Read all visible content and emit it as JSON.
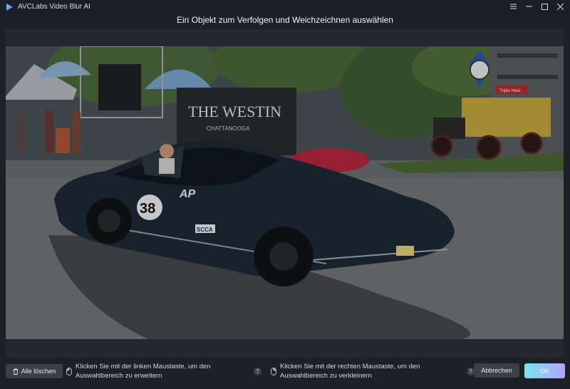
{
  "app": {
    "title": "AVCLabs Video Blur AI"
  },
  "dialog": {
    "title": "Ein Objekt zum Verfolgen und Weichzeichnen auswählen"
  },
  "window_controls": {
    "menu_icon": "hamburger-icon",
    "minimize_icon": "minimize-icon",
    "maximize_icon": "maximize-icon",
    "close_icon": "close-icon"
  },
  "video": {
    "sign_line1": "THE WESTIN",
    "sign_line2": "CHATTANOOGA",
    "car_number": "38",
    "car_letters": "AP",
    "car_badge": "SCCA",
    "truck_sign": "Triple Heat"
  },
  "bottom": {
    "clear_label": "Alle löschen",
    "hint_left": "Klicken Sie mit der linken Maustaste, um den Auswahlbereich zu erweitern",
    "hint_right": "Klicken Sie mit der rechten Maustaste, um den Auswahlbereich zu verkleinern",
    "help_glyph": "?",
    "cancel_label": "Abbrechen",
    "ok_label": "OK"
  },
  "colors": {
    "accent_gradient_start": "#7ae3ef",
    "accent_gradient_end": "#b7a4f7",
    "background": "#1d2027"
  }
}
